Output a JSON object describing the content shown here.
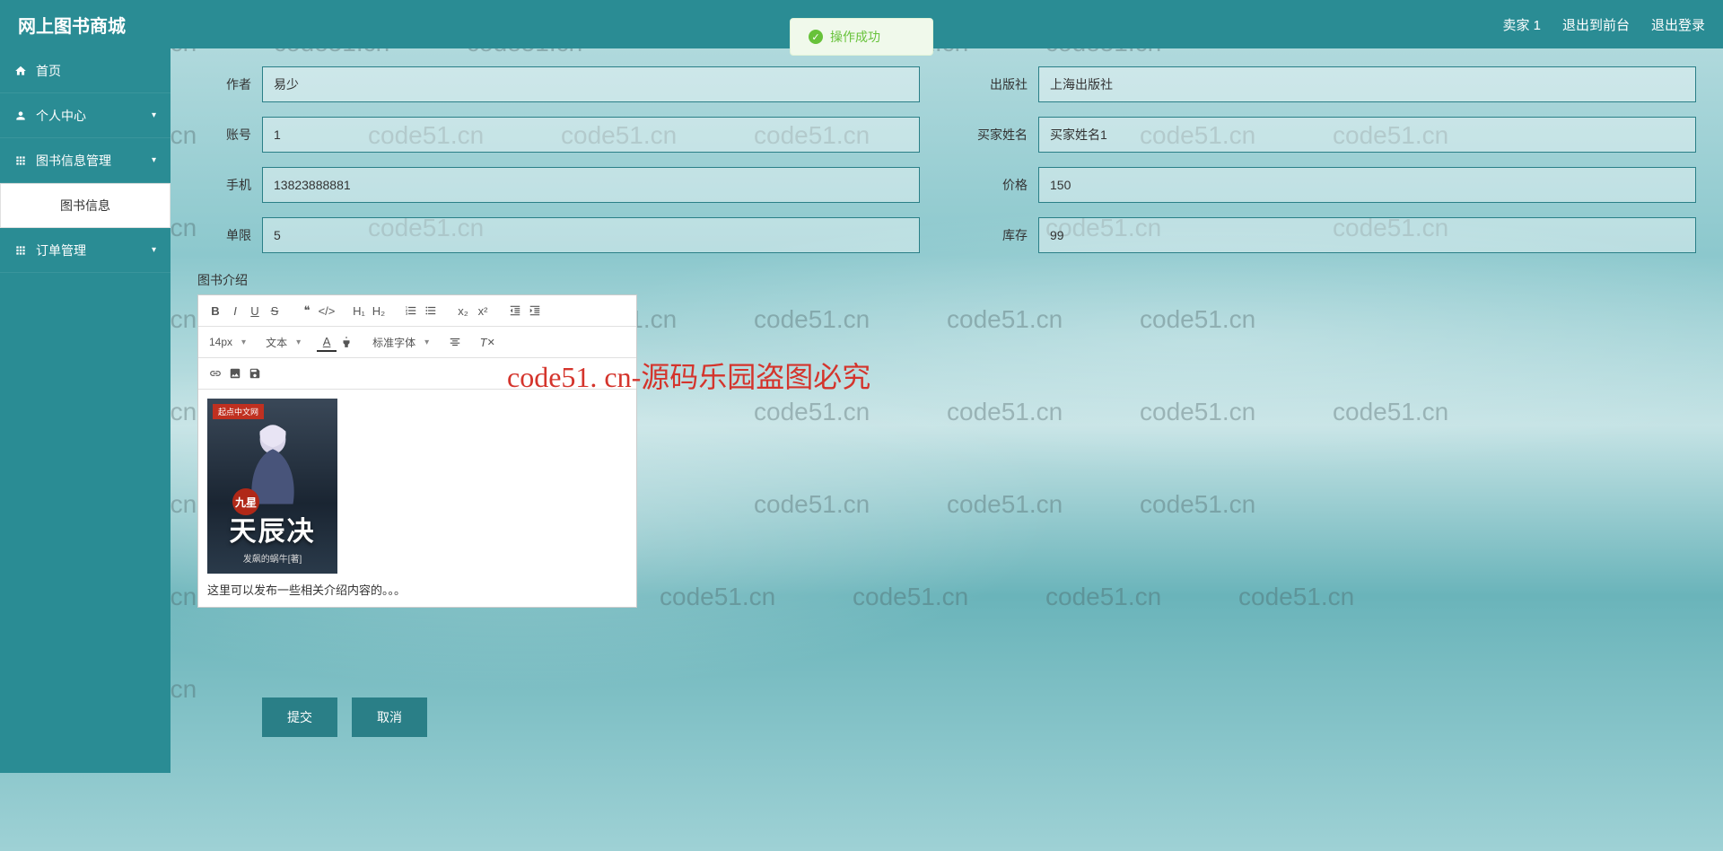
{
  "header": {
    "title": "网上图书商城",
    "user": "卖家 1",
    "link_front": "退出到前台",
    "link_logout": "退出登录"
  },
  "sidebar": {
    "home": "首页",
    "personal": "个人中心",
    "book_mgmt": "图书信息管理",
    "book_info": "图书信息",
    "order_mgmt": "订单管理"
  },
  "toast": {
    "message": "操作成功"
  },
  "form": {
    "author": {
      "label": "作者",
      "value": "易少"
    },
    "publisher": {
      "label": "出版社",
      "value": "上海出版社"
    },
    "account": {
      "label": "账号",
      "value": "1"
    },
    "buyer": {
      "label": "买家姓名",
      "value": "买家姓名1"
    },
    "phone": {
      "label": "手机",
      "value": "13823888881"
    },
    "price": {
      "label": "价格",
      "value": "150"
    },
    "limit": {
      "label": "单限",
      "value": "5"
    },
    "stock": {
      "label": "库存",
      "value": "99"
    }
  },
  "editor": {
    "label": "图书介绍",
    "font_size": "14px",
    "element_type": "文本",
    "font_family": "标准字体",
    "cover_badge": "起点中文网",
    "cover_circle": "九星",
    "cover_title": "天辰决",
    "cover_author": "发飙的蜗牛[著]",
    "text": "这里可以发布一些相关介绍内容的。。。"
  },
  "actions": {
    "submit": "提交",
    "cancel": "取消"
  },
  "overlay": "code51. cn-源码乐园盗图必究",
  "watermark": "code51.cn"
}
